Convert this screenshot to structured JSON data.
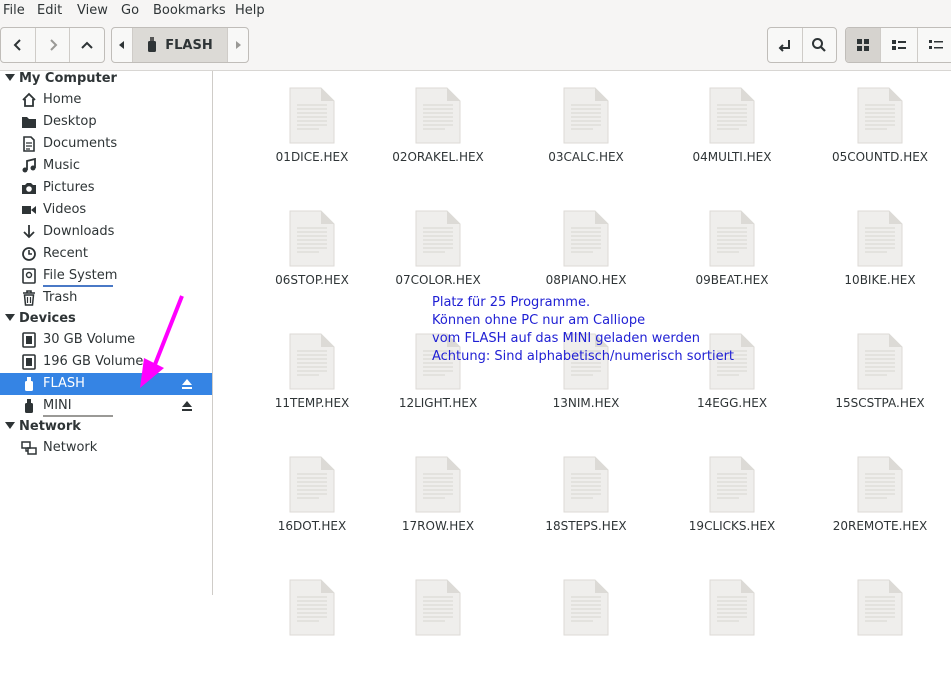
{
  "menu": [
    "File",
    "Edit",
    "View",
    "Go",
    "Bookmarks",
    "Help"
  ],
  "path": {
    "current": "FLASH"
  },
  "sidebar": {
    "sections": [
      {
        "title": "My Computer",
        "items": [
          {
            "label": "Home",
            "icon": "home-icon"
          },
          {
            "label": "Desktop",
            "icon": "folder-icon"
          },
          {
            "label": "Documents",
            "icon": "documents-icon"
          },
          {
            "label": "Music",
            "icon": "music-icon"
          },
          {
            "label": "Pictures",
            "icon": "camera-icon"
          },
          {
            "label": "Videos",
            "icon": "video-icon"
          },
          {
            "label": "Downloads",
            "icon": "download-icon"
          },
          {
            "label": "Recent",
            "icon": "clock-icon"
          },
          {
            "label": "File System",
            "icon": "filesystem-icon"
          },
          {
            "label": "Trash",
            "icon": "trash-icon"
          }
        ]
      },
      {
        "title": "Devices",
        "items": [
          {
            "label": "30 GB Volume",
            "icon": "drive-icon"
          },
          {
            "label": "196 GB Volume",
            "icon": "drive-icon"
          },
          {
            "label": "FLASH",
            "icon": "usb-icon",
            "selected": true,
            "eject": true
          },
          {
            "label": "MINI",
            "icon": "usb-icon",
            "eject": true
          }
        ]
      },
      {
        "title": "Network",
        "items": [
          {
            "label": "Network",
            "icon": "network-icon"
          }
        ]
      }
    ]
  },
  "files": [
    "01DICE.HEX",
    "02ORAKEL.HEX",
    "03CALC.HEX",
    "04MULTI.HEX",
    "05COUNTD.HEX",
    "06STOP.HEX",
    "07COLOR.HEX",
    "08PIANO.HEX",
    "09BEAT.HEX",
    "10BIKE.HEX",
    "11TEMP.HEX",
    "12LIGHT.HEX",
    "13NIM.HEX",
    "14EGG.HEX",
    "15SCSTPA.HEX",
    "16DOT.HEX",
    "17ROW.HEX",
    "18STEPS.HEX",
    "19CLICKS.HEX",
    "20REMOTE.HEX",
    "",
    "",
    "",
    "",
    ""
  ],
  "annotation": [
    "Platz für 25 Programme.",
    "Können ohne PC nur am Calliope",
    "vom FLASH auf das MINI geladen werden",
    "Achtung: Sind alphabetisch/numerisch sortiert"
  ],
  "colors": {
    "selection": "#3584e4",
    "annotation": "#1f1fd4",
    "arrow": "#ff00ff"
  }
}
